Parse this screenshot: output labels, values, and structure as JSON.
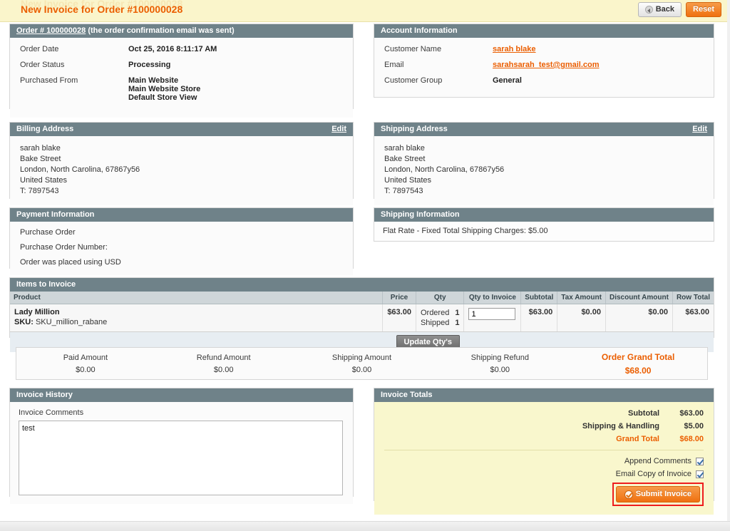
{
  "page": {
    "title": "New Invoice for Order #100000028",
    "ghost_title": "New Invoice for Order #100000028",
    "accent_orange": "#eb5e00",
    "panel_header_bg": "#6f8289",
    "totals_bg": "#f9f7cd",
    "highlight_box_color": "#ee1d1d"
  },
  "toolbar": {
    "back_label": "Back",
    "back_icon": "back-arrow-icon",
    "reset_label": "Reset"
  },
  "order_panel": {
    "title_link": "Order # 100000028",
    "title_suffix": "(the order confirmation email was sent)",
    "rows": [
      {
        "label": "Order Date",
        "value": "Oct 25, 2016 8:11:17 AM"
      },
      {
        "label": "Order Status",
        "value": "Processing"
      }
    ],
    "purchased_from_label": "Purchased From",
    "purchased_from_lines": [
      "Main Website",
      "Main Website Store",
      "Default Store View"
    ]
  },
  "account_panel": {
    "title": "Account Information",
    "rows": [
      {
        "label": "Customer Name",
        "value": "sarah blake",
        "link": true
      },
      {
        "label": "Email",
        "value": "sarahsarah_test@gmail.com",
        "link": true
      },
      {
        "label": "Customer Group",
        "value": "General",
        "link": false
      }
    ]
  },
  "billing_panel": {
    "title": "Billing Address",
    "edit_label": "Edit",
    "lines": [
      "sarah blake",
      "Bake Street",
      "London, North Carolina, 67867y56",
      "United States",
      "T: 7897543"
    ]
  },
  "shipping_panel": {
    "title": "Shipping Address",
    "edit_label": "Edit",
    "lines": [
      "sarah blake",
      "Bake Street",
      "London, North Carolina, 67867y56",
      "United States",
      "T: 7897543"
    ]
  },
  "payment_panel": {
    "title": "Payment Information",
    "lines": [
      "Purchase Order",
      "Purchase Order Number:",
      "Order was placed using USD"
    ]
  },
  "shipping_info_panel": {
    "title": "Shipping Information",
    "method": "Flat Rate - Fixed Total Shipping Charges: $5.00"
  },
  "items_panel": {
    "title": "Items to Invoice",
    "columns": [
      "Product",
      "Price",
      "Qty",
      "Qty to Invoice",
      "Subtotal",
      "Tax Amount",
      "Discount Amount",
      "Row Total"
    ],
    "row": {
      "product_name": "Lady Million",
      "sku_label": "SKU:",
      "sku_value": "SKU_million_rabane",
      "price": "$63.00",
      "qty_ordered_label": "Ordered",
      "qty_ordered_value": "1",
      "qty_shipped_label": "Shipped",
      "qty_shipped_value": "1",
      "qty_to_invoice": "1",
      "subtotal": "$63.00",
      "tax_amount": "$0.00",
      "discount_amount": "$0.00",
      "row_total": "$63.00"
    },
    "update_qty_label": "Update Qty's"
  },
  "amounts": [
    {
      "label": "Paid Amount",
      "value": "$0.00",
      "grand": false
    },
    {
      "label": "Refund Amount",
      "value": "$0.00",
      "grand": false
    },
    {
      "label": "Shipping Amount",
      "value": "$0.00",
      "grand": false
    },
    {
      "label": "Shipping Refund",
      "value": "$0.00",
      "grand": false
    },
    {
      "label": "Order Grand Total",
      "value": "$68.00",
      "grand": true
    }
  ],
  "history_panel": {
    "title": "Invoice History",
    "comments_label": "Invoice Comments",
    "comments_value": "test",
    "comments_placeholder": ""
  },
  "totals_panel": {
    "title": "Invoice Totals",
    "rows": [
      {
        "label": "Subtotal",
        "value": "$63.00",
        "grand": false
      },
      {
        "label": "Shipping & Handling",
        "value": "$5.00",
        "grand": false
      },
      {
        "label": "Grand Total",
        "value": "$68.00",
        "grand": true
      }
    ],
    "append_comments_label": "Append Comments",
    "append_comments_checked": true,
    "email_copy_label": "Email Copy of Invoice",
    "email_copy_checked": true,
    "submit_label": "Submit Invoice",
    "submit_icon": "circle-check-icon"
  }
}
